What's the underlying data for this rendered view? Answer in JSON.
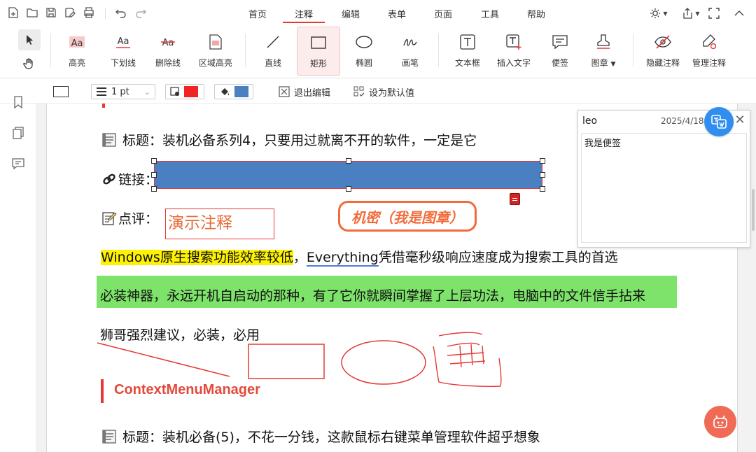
{
  "menu": {
    "tabs": [
      "首页",
      "注释",
      "编辑",
      "表单",
      "页面",
      "工具",
      "帮助"
    ],
    "active": "注释"
  },
  "ribbon": {
    "tools": [
      {
        "label": "高亮",
        "icon": "highlight-icon"
      },
      {
        "label": "下划线",
        "icon": "underline-icon"
      },
      {
        "label": "删除线",
        "icon": "strikethrough-icon"
      },
      {
        "label": "区域高亮",
        "icon": "area-highlight-icon"
      },
      {
        "label": "直线",
        "icon": "line-icon"
      },
      {
        "label": "矩形",
        "icon": "rectangle-icon"
      },
      {
        "label": "椭圆",
        "icon": "ellipse-icon"
      },
      {
        "label": "画笔",
        "icon": "pen-icon"
      },
      {
        "label": "文本框",
        "icon": "textbox-icon"
      },
      {
        "label": "插入文字",
        "icon": "insert-text-icon"
      },
      {
        "label": "便签",
        "icon": "sticky-note-icon"
      },
      {
        "label": "图章",
        "icon": "stamp-icon"
      },
      {
        "label": "隐藏注释",
        "icon": "hide-annotations-icon"
      },
      {
        "label": "管理注释",
        "icon": "manage-annotations-icon"
      }
    ],
    "active": "矩形"
  },
  "propbar": {
    "line_width": "1 pt",
    "stroke_color": "#f02424",
    "fill_color": "#4a7fc1",
    "exit_edit": "退出编辑",
    "set_default": "设为默认值"
  },
  "document": {
    "title_line": "标题：装机必备系列4，只要用过就离不开的软件，一定是它",
    "link_label": "链接：",
    "comment_label": "点评：",
    "demo_annotation": "演示注释",
    "stamp_text": "机密（我是图章）",
    "p1_highlight": "Windows原生搜索功能效率较低",
    "p1_sep": "，",
    "p1_underline": "Everything",
    "p1_strike": "凭借毫秒级响应速度成为搜索工具的首选",
    "p2": "必装神器，永远开机自启动的那种，有了它你就瞬间掌握了上层功法，电脑中的文件信手拈来",
    "p3": "狮哥强烈建议，必装，必用",
    "section_heading": "ContextMenuManager",
    "title_line_2": "标题：装机必备(5)，不花一分钱，这款鼠标右键菜单管理软件超乎想象"
  },
  "note": {
    "author": "leo",
    "time": "2025/4/18 1",
    "content": "我是便签"
  },
  "colors": {
    "accent": "#e53935",
    "highlight_yellow": "#fff200",
    "highlight_green": "#7ee36a",
    "stamp": "#f26b3a",
    "rect_fill": "#4a7fc1"
  }
}
